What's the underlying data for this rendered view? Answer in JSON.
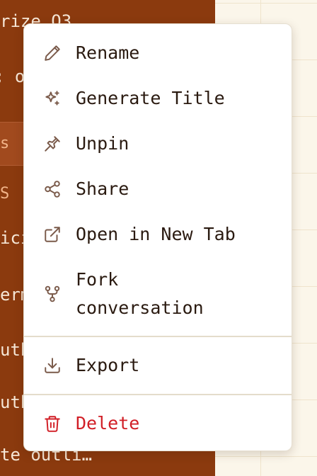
{
  "sidebar": {
    "items": [
      {
        "text": "rize Q3"
      },
      {
        "text": "; or"
      },
      {
        "text": "s"
      },
      {
        "text": "S"
      },
      {
        "text": "ici"
      },
      {
        "text": "erm"
      },
      {
        "text": "uth"
      },
      {
        "text": "uth"
      },
      {
        "text": "te outli…"
      }
    ]
  },
  "menu": {
    "items": [
      {
        "label": "Rename",
        "icon": "pencil-icon"
      },
      {
        "label": "Generate Title",
        "icon": "sparkles-icon"
      },
      {
        "label": "Unpin",
        "icon": "pin-icon"
      },
      {
        "label": "Share",
        "icon": "share-icon"
      },
      {
        "label": "Open in New Tab",
        "icon": "external-link-icon"
      },
      {
        "label": "Fork\nconversation",
        "icon": "git-fork-icon"
      },
      {
        "label": "Export",
        "icon": "download-icon"
      },
      {
        "label": "Delete",
        "icon": "trash-icon"
      }
    ]
  },
  "colors": {
    "sidebar_bg": "#8b3a0e",
    "icon": "#7a5a4a",
    "danger": "#d11e26",
    "text": "#2a1a10"
  }
}
